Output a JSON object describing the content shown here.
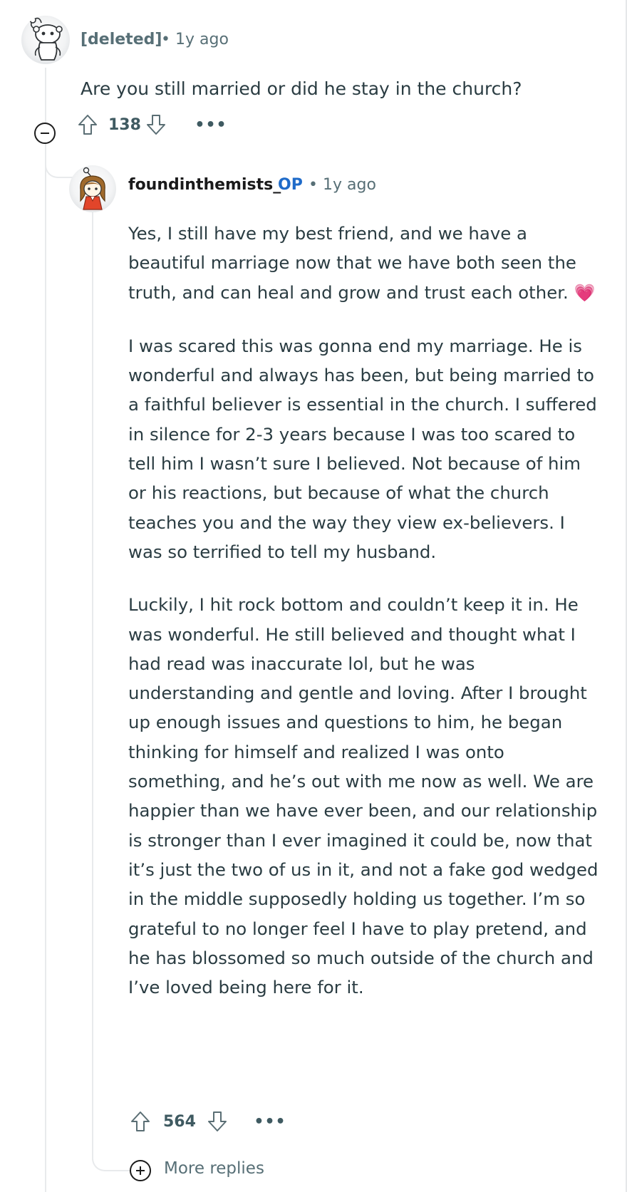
{
  "parent_comment": {
    "author": "[deleted]",
    "separator": "•",
    "timestamp": "1y ago",
    "avatar_icon": "reddit-snoo-default-avatar",
    "body": "Are you still married or did he stay in the church?",
    "upvote_icon": "upvote-arrow-icon",
    "score": "138",
    "downvote_icon": "downvote-arrow-icon",
    "more_options": "•••",
    "collapse_icon": "collapse-minus-icon"
  },
  "reply": {
    "author": "foundinthemists_",
    "op_badge": "OP",
    "separator": "•",
    "timestamp": "1y ago",
    "avatar_icon": "reddit-custom-avatar",
    "paragraphs": [
      "Yes, I still have my best friend, and we have a beautiful marriage now that we have both seen the truth, and can heal and grow and trust each other.",
      "I was scared this was gonna end my marriage. He is wonderful and always has been, but being married to a faithful believer is essential in the church. I suffered in silence for 2-3 years because I was too scared to tell him I wasn’t sure I believed. Not because of him or his reactions, but because of what the church teaches you and the way they view ex-believers. I was so terrified to tell my husband.",
      "Luckily, I hit rock bottom and couldn’t keep it in. He was wonderful. He still believed and thought what I had read was inaccurate lol, but he was understanding and gentle and loving. After I brought up enough issues and questions to him, he began thinking for himself and realized I was onto something, and he’s out with me now as well. We are happier than we have ever been, and our relationship is stronger than I ever imagined it could be, now that it’s just the two of us in it, and not a fake god wedged in the middle supposedly holding us together. I’m so grateful to no longer feel I have to play pretend, and he has blossomed so much outside of the church and I’ve loved being here for it."
    ],
    "heart_emoji": "💗",
    "score": "564",
    "more_options": "•••"
  },
  "more_replies": {
    "icon": "plus-circle-icon",
    "label": "More replies"
  },
  "colors": {
    "meta_gray": "#576f76",
    "op_blue": "#1f6bc9",
    "body_text": "#2a3c42",
    "thread_line": "#e8eaec",
    "heart": "#e8326f"
  }
}
